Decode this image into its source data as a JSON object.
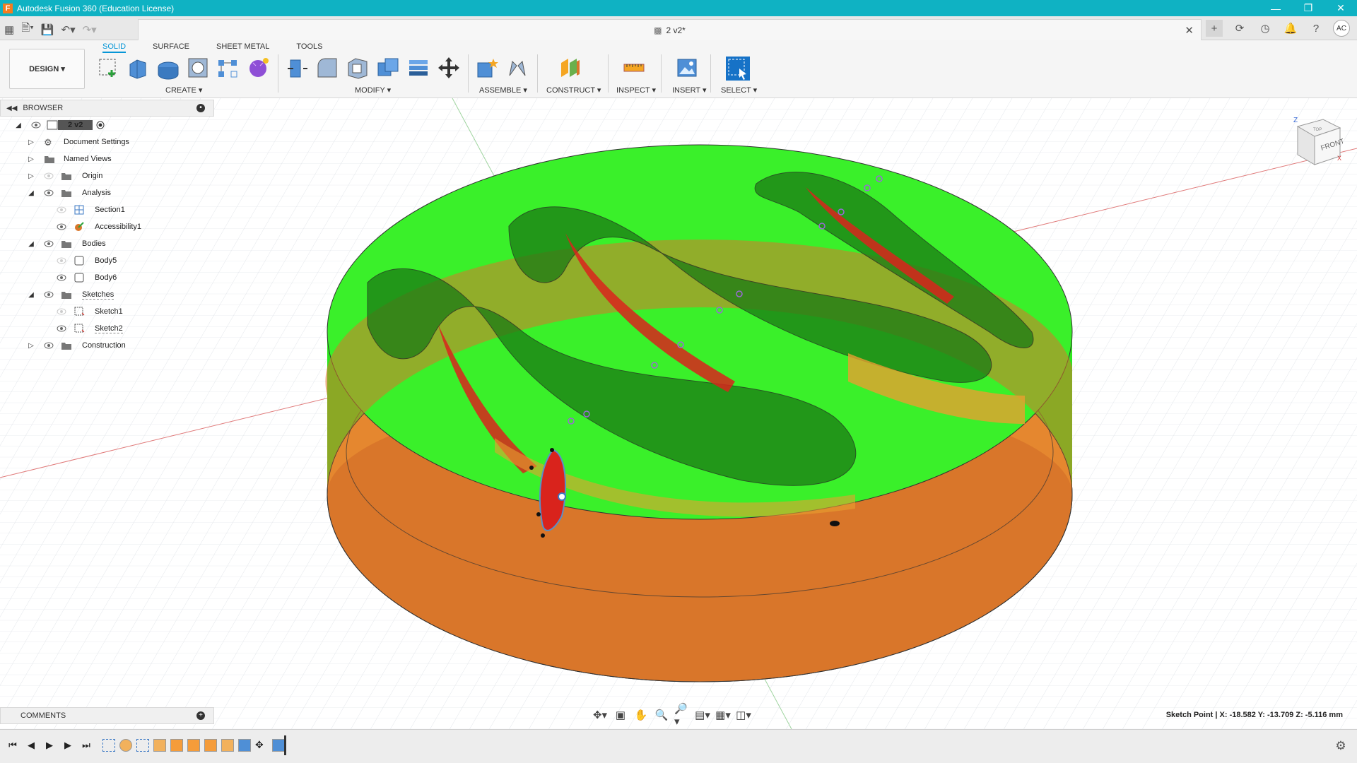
{
  "window": {
    "title": "Autodesk Fusion 360 (Education License)",
    "app_icon": "F"
  },
  "document": {
    "tab_title": "2 v2*"
  },
  "user": {
    "initials": "AC"
  },
  "ribbon": {
    "workspace": "DESIGN",
    "tabs": [
      "SOLID",
      "SURFACE",
      "SHEET METAL",
      "TOOLS"
    ],
    "active_tab": "SOLID",
    "groups": {
      "create": "CREATE",
      "modify": "MODIFY",
      "assemble": "ASSEMBLE",
      "construct": "CONSTRUCT",
      "inspect": "INSPECT",
      "insert": "INSERT",
      "select": "SELECT"
    }
  },
  "browser": {
    "title": "BROWSER",
    "root": "2 v2",
    "items": [
      {
        "label": "Document Settings"
      },
      {
        "label": "Named Views"
      },
      {
        "label": "Origin"
      },
      {
        "label": "Analysis"
      },
      {
        "label": "Section1"
      },
      {
        "label": "Accessibility1"
      },
      {
        "label": "Bodies"
      },
      {
        "label": "Body5"
      },
      {
        "label": "Body6"
      },
      {
        "label": "Sketches"
      },
      {
        "label": "Sketch1"
      },
      {
        "label": "Sketch2"
      },
      {
        "label": "Construction"
      }
    ]
  },
  "comments": {
    "title": "COMMENTS"
  },
  "viewcube": {
    "top": "TOP",
    "front": "FRONT",
    "axis_x": "X",
    "axis_z": "Z"
  },
  "status": {
    "text": "Sketch Point | X: -18.582 Y: -13.709 Z: -5.116 mm"
  },
  "colors": {
    "titlebar": "#0fb2c3",
    "accent": "#0696d7",
    "green_body": "#22e01c",
    "orange_body": "#d9762a",
    "red_region": "#d9231c"
  }
}
